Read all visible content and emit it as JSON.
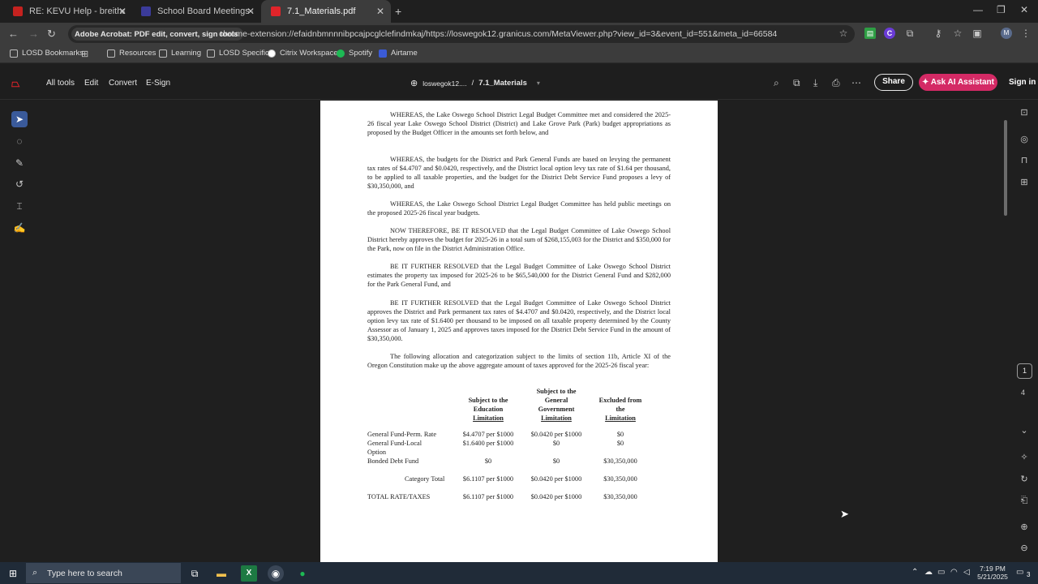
{
  "browser": {
    "tabs": [
      {
        "title": "RE: KEVU Help - breitham@lo",
        "favicon_color": "#c5221f",
        "active": false
      },
      {
        "title": "School Board Meetings - Lake",
        "favicon_color": "#3b3b9a",
        "active": false
      },
      {
        "title": "7.1_Materials.pdf",
        "favicon_color": "#e0242a",
        "active": true
      }
    ],
    "new_tab": "+",
    "extension_chip": "Adobe Acrobat: PDF edit, convert, sign tools",
    "url": "chrome-extension://efaidnbmnnnibpcajpcglclefindmkaj/https://loswegok12.granicus.com/MetaViewer.php?view_id=3&event_id=551&meta_id=66584",
    "profile_initial": "M",
    "bookmarks": [
      "LOSD Bookmarks",
      "Resources",
      "Learning",
      "LOSD Specific",
      "Citrix Workspace",
      "Spotify",
      "Airtame"
    ]
  },
  "acrobat": {
    "menu": [
      "All tools",
      "Edit",
      "Convert",
      "E-Sign"
    ],
    "breadcrumb_site": "loswegok12....",
    "breadcrumb_sep": "/",
    "breadcrumb_file": "7.1_Materials",
    "share_label": "Share",
    "ai_label": "Ask AI Assistant",
    "signin_label": "Sign in",
    "current_page": "1",
    "total_pages": "4"
  },
  "document": {
    "paragraphs": [
      "WHEREAS, the Lake Oswego School District Legal Budget Committee met and considered the 2025-26 fiscal year Lake Oswego School District (District) and Lake Grove Park (Park) budget appropriations as proposed by the Budget Officer in the amounts set forth below, and",
      "WHEREAS, the budgets for the District and Park General Funds are based on levying the permanent tax rates of $4.4707 and $0.0420, respectively, and the District local option levy tax rate of $1.64 per thousand, to be applied to all taxable properties, and the budget for the District Debt Service Fund proposes a levy of $30,350,000, and",
      "WHEREAS, the Lake Oswego School District Legal Budget Committee has held public meetings on the proposed 2025-26 fiscal year budgets.",
      "NOW THEREFORE, BE IT RESOLVED that the Legal Budget Committee of Lake Oswego School District hereby approves the budget for 2025-26 in a total sum of $268,155,003 for the District and $350,000 for the Park, now on file in the District Administration Office.",
      "BE IT FURTHER RESOLVED that the Legal Budget Committee of Lake Oswego School District estimates the property tax imposed for 2025-26 to be $65,540,000 for the District General Fund and $282,000 for the Park General Fund, and",
      "BE IT FURTHER RESOLVED that the Legal Budget Committee of Lake Oswego School District approves the District and Park permanent tax rates of $4.4707 and $0.0420, respectively, and the District local option levy tax rate of $1.6400 per thousand to be imposed on all taxable property determined by the County Assessor as of January 1, 2025 and approves taxes imposed for the District Debt Service Fund in the amount of $30,350,000.",
      "The following allocation and categorization subject to the limits of section 11b, Article XI of the Oregon Constitution make up the above aggregate amount of taxes approved for the 2025-26 fiscal year:"
    ],
    "table": {
      "headers": [
        {
          "lines": [
            "Subject to the",
            "Education"
          ],
          "underlined": "Limitation"
        },
        {
          "lines": [
            "Subject to the",
            "General",
            "Government"
          ],
          "underlined": "Limitation"
        },
        {
          "lines": [
            "Excluded from",
            "the"
          ],
          "underlined": "Limitation"
        }
      ],
      "rows": [
        {
          "label": "General Fund-Perm. Rate",
          "c1": "$4.4707 per $1000",
          "c2": "$0.0420 per $1000",
          "c3": "$0"
        },
        {
          "label": "General Fund-Local",
          "label2": "Option",
          "c1": "$1.6400 per $1000",
          "c2": "$0",
          "c3": "$0"
        },
        {
          "label": "Bonded Debt Fund",
          "c1": "$0",
          "c2": "$0",
          "c3": "$30,350,000"
        },
        {
          "label": "Category Total",
          "c1": "$6.1107 per $1000",
          "c2": "$0.0420 per $1000",
          "c3": "$30,350,000"
        },
        {
          "label": "TOTAL RATE/TAXES",
          "c1": "$6.1107 per $1000",
          "c2": "$0.0420 per $1000",
          "c3": "$30,350,000"
        }
      ]
    }
  },
  "taskbar": {
    "search_placeholder": "Type here to search",
    "time": "7:19 PM",
    "date": "5/21/2025",
    "notification_count": "3"
  }
}
